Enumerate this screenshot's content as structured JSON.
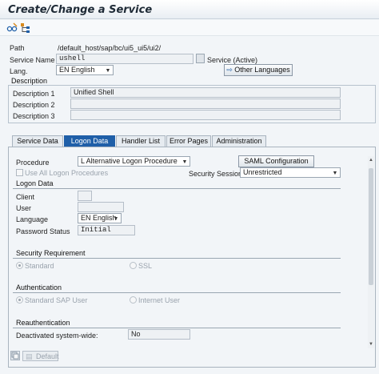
{
  "window": {
    "title": "Create/Change a Service"
  },
  "toolbar": {
    "icons": [
      "glasses-edit-icon",
      "hierarchy-icon"
    ]
  },
  "header_fields": {
    "path": {
      "label": "Path",
      "value": "/default_host/sap/bc/ui5_ui5/ui2/"
    },
    "service_name": {
      "label": "Service Name",
      "value": "ushell",
      "status": "Service (Active)"
    },
    "lang": {
      "label": "Lang.",
      "value": "EN English"
    },
    "other_languages": "Other Languages"
  },
  "description": {
    "header": "Description",
    "rows": [
      {
        "label": "Description 1",
        "value": "Unified Shell"
      },
      {
        "label": "Description 2",
        "value": ""
      },
      {
        "label": "Description 3",
        "value": ""
      }
    ]
  },
  "tabs": [
    {
      "label": "Service Data",
      "active": false
    },
    {
      "label": "Logon Data",
      "active": true
    },
    {
      "label": "Handler List",
      "active": false
    },
    {
      "label": "Error Pages",
      "active": false
    },
    {
      "label": "Administration",
      "active": false
    }
  ],
  "logon_tab": {
    "procedure": {
      "label": "Procedure",
      "value": "L Alternative Logon Procedure"
    },
    "saml_button": "SAML Configuration",
    "use_all": {
      "label": "Use All Logon Procedures",
      "checked": false
    },
    "security_session": {
      "label": "Security Session:",
      "value": "Unrestricted"
    },
    "logon_data": {
      "header": "Logon Data",
      "client": {
        "label": "Client",
        "value": ""
      },
      "user": {
        "label": "User",
        "value": ""
      },
      "language": {
        "label": "Language",
        "value": "EN English"
      },
      "password_status": {
        "label": "Password Status",
        "value": "Initial"
      }
    },
    "security_requirement": {
      "header": "Security Requirement",
      "standard": "Standard",
      "ssl": "SSL",
      "selected": "Standard"
    },
    "authentication": {
      "header": "Authentication",
      "standard": "Standard SAP User",
      "internet": "Internet User",
      "selected": "Standard SAP User"
    },
    "reauthentication": {
      "header": "Reauthentication",
      "deactivated": {
        "label": "Deactivated system-wide:",
        "value": "No"
      }
    },
    "default_button": "Default"
  }
}
